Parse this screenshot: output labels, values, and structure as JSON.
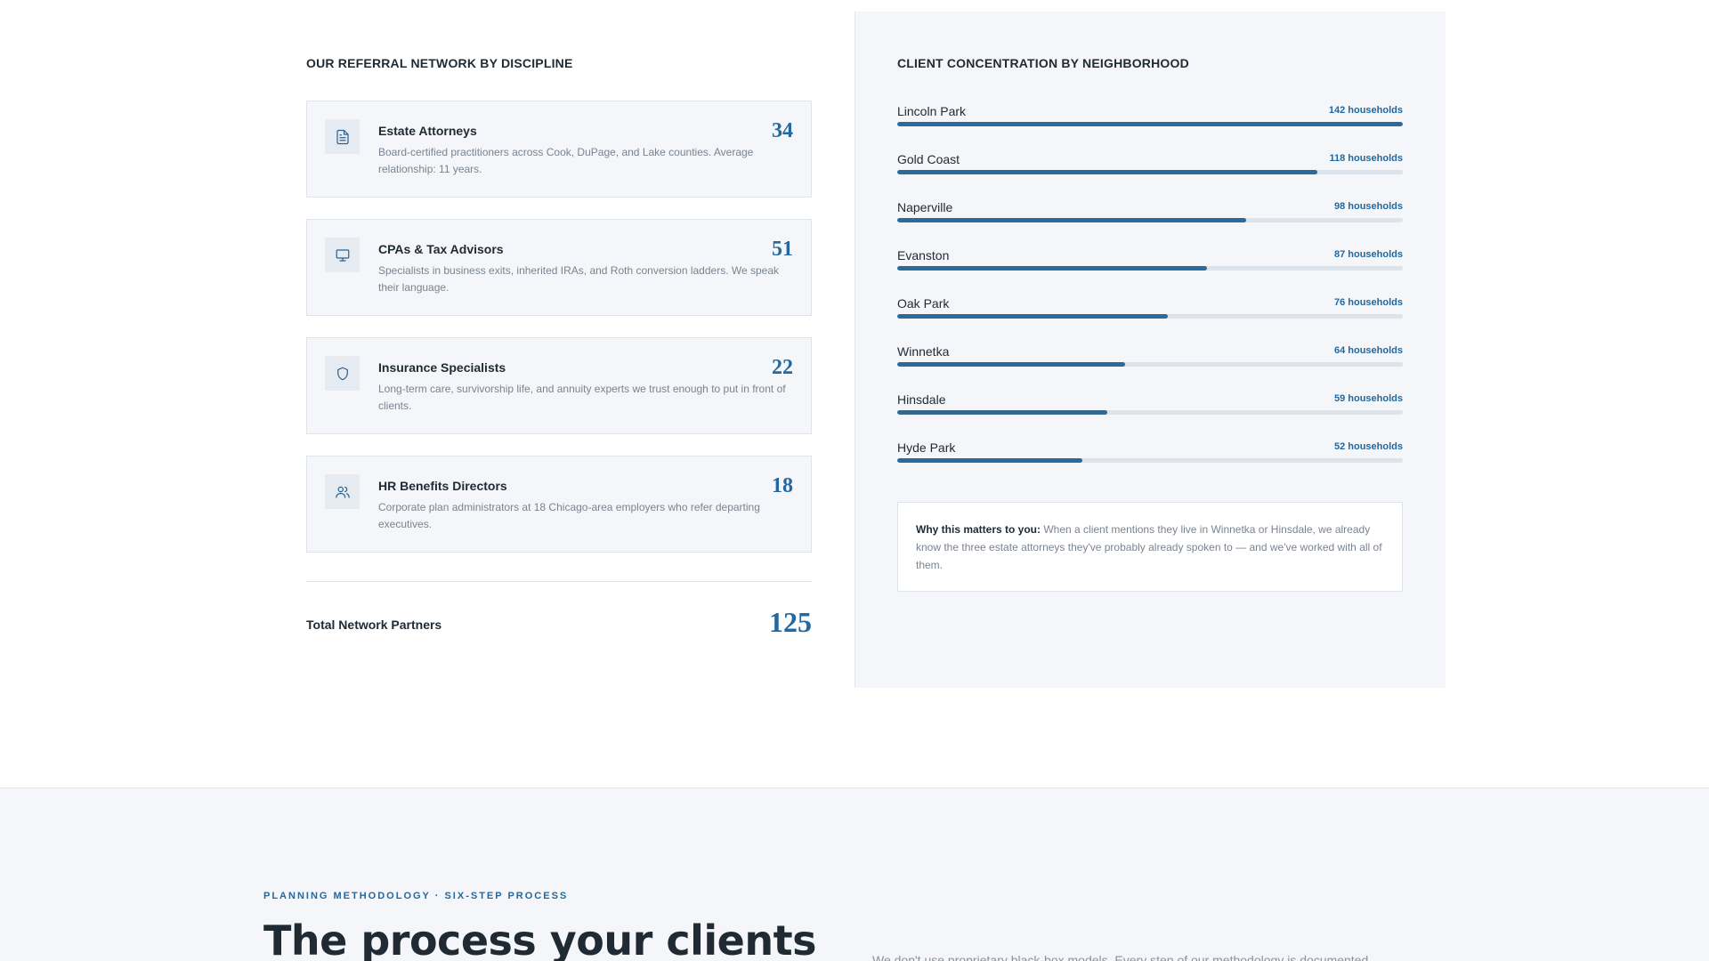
{
  "referral": {
    "heading": "OUR REFERRAL NETWORK BY DISCIPLINE",
    "cards": [
      {
        "icon": "document-icon",
        "title": "Estate Attorneys",
        "count": "34",
        "desc": "Board-certified practitioners across Cook, DuPage, and Lake counties. Average relationship: 11 years."
      },
      {
        "icon": "monitor-icon",
        "title": "CPAs & Tax Advisors",
        "count": "51",
        "desc": "Specialists in business exits, inherited IRAs, and Roth conversion ladders. We speak their language."
      },
      {
        "icon": "shield-icon",
        "title": "Insurance Specialists",
        "count": "22",
        "desc": "Long-term care, survivorship life, and annuity experts we trust enough to put in front of clients."
      },
      {
        "icon": "users-icon",
        "title": "HR Benefits Directors",
        "count": "18",
        "desc": "Corporate plan administrators at 18 Chicago-area employers who refer departing executives."
      }
    ],
    "total_label": "Total Network Partners",
    "total_value": "125"
  },
  "neighborhoods": {
    "heading": "CLIENT CONCENTRATION BY NEIGHBORHOOD",
    "items": [
      {
        "name": "Lincoln Park",
        "count": "142 households",
        "households": 142
      },
      {
        "name": "Gold Coast",
        "count": "118 households",
        "households": 118
      },
      {
        "name": "Naperville",
        "count": "98 households",
        "households": 98
      },
      {
        "name": "Evanston",
        "count": "87 households",
        "households": 87
      },
      {
        "name": "Oak Park",
        "count": "76 households",
        "households": 76
      },
      {
        "name": "Winnetka",
        "count": "64 households",
        "households": 64
      },
      {
        "name": "Hinsdale",
        "count": "59 households",
        "households": 59
      },
      {
        "name": "Hyde Park",
        "count": "52 households",
        "households": 52
      }
    ],
    "note_label": "Why this matters to you:",
    "note_text": "When a client mentions they live in Winnetka or Hinsdale, we already know the three estate attorneys they've probably already spoken to — and we've worked with all of them."
  },
  "methodology": {
    "eyebrow": "PLANNING METHODOLOGY · SIX-STEP PROCESS",
    "title": "The process your clients",
    "intro": "We don't use proprietary black-box models. Every step of our methodology is documented"
  },
  "colors": {
    "accent": "#23689e",
    "bar": "#2a6a9c",
    "panel": "#f4f6f9"
  }
}
